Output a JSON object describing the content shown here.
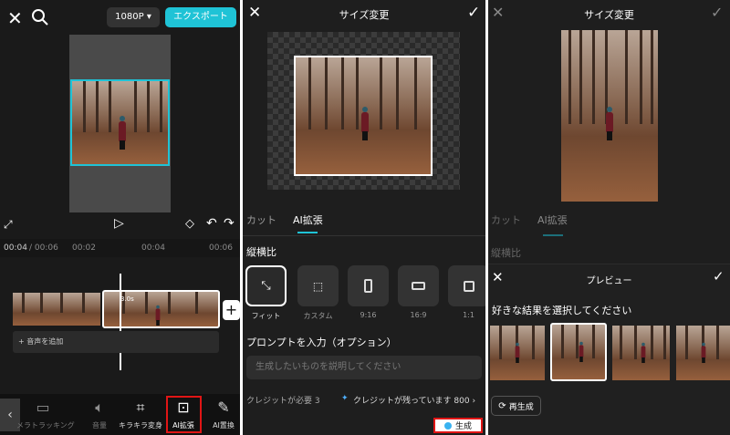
{
  "panel1": {
    "resolution_label": "1080P ▾",
    "export_label": "エクスポート",
    "time_current": "00:04",
    "time_total": "/ 00:06",
    "ruler_ticks": [
      "00:02",
      "00:04",
      "00:06"
    ],
    "clip_duration": "3.0s",
    "add_audio_label": "+ 音声を追加",
    "tools": [
      {
        "label": "メラトラッキング",
        "icon": "tracking-icon"
      },
      {
        "label": "音量",
        "icon": "volume-icon"
      },
      {
        "label": "キラキラ変身",
        "icon": "crop-icon"
      },
      {
        "label": "AI拡張",
        "icon": "ai-expand-icon"
      },
      {
        "label": "AI置換",
        "icon": "ai-replace-icon"
      }
    ]
  },
  "panel2": {
    "title": "サイズ変更",
    "tabs": [
      "カット",
      "AI拡張"
    ],
    "section_ratio": "縦横比",
    "ratios": [
      {
        "label": "フィット"
      },
      {
        "label": "カスタム"
      },
      {
        "label": "9:16"
      },
      {
        "label": "16:9"
      },
      {
        "label": "1:1"
      }
    ],
    "prompt_heading": "プロンプトを入力（オプション）",
    "prompt_placeholder": "生成したいものを説明してください",
    "credits_required": "クレジットが必要 3",
    "credits_remaining": "クレジットが残っています 800 ›",
    "generate_label": "生成"
  },
  "panel3": {
    "title": "サイズ変更",
    "tabs": [
      "カット",
      "AI拡張"
    ],
    "section_ratio": "縦横比",
    "preview_title": "プレビュー",
    "choose_prompt": "好きな結果を選択してください",
    "regenerate_label": "再生成"
  },
  "colors": {
    "accent": "#1fc3d6",
    "highlight": "#e01515"
  }
}
